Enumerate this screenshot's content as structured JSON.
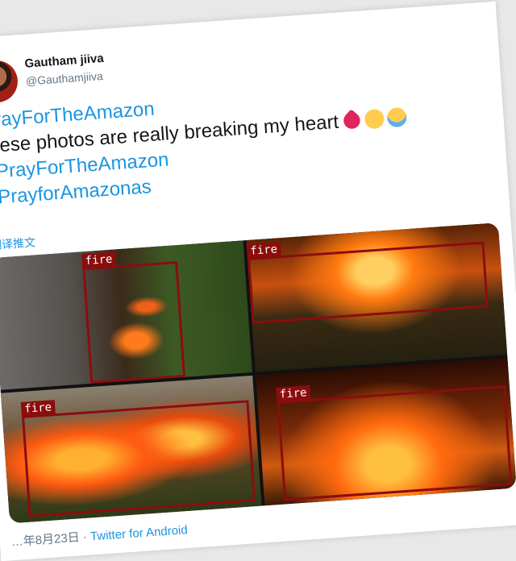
{
  "author": {
    "name": "Gautham jiiva",
    "handle": "@Gauthamjiiva"
  },
  "tweet": {
    "lines": [
      {
        "text": "PrayForTheAmazon",
        "kind": "hashtag"
      },
      {
        "text": "these photos are really breaking my heart",
        "kind": "text"
      },
      {
        "text": "#PrayForTheAmazon",
        "kind": "hashtag"
      },
      {
        "text": "#PrayforAmazonas",
        "kind": "hashtag"
      }
    ],
    "emojis": [
      "broken-heart-icon",
      "crying-face-icon",
      "sobbing-face-icon"
    ],
    "translate_label": "翻译推文"
  },
  "photos": [
    {
      "detection_label": "fire"
    },
    {
      "detection_label": "fire"
    },
    {
      "detection_label": "fire"
    },
    {
      "detection_label": "fire"
    }
  ],
  "footer": {
    "date": "…年8月23日",
    "separator": " · ",
    "source": "Twitter for Android"
  },
  "colors": {
    "link": "#1b95e0",
    "detection_box": "#8b0d0d",
    "text": "#14171a",
    "muted": "#657786"
  }
}
